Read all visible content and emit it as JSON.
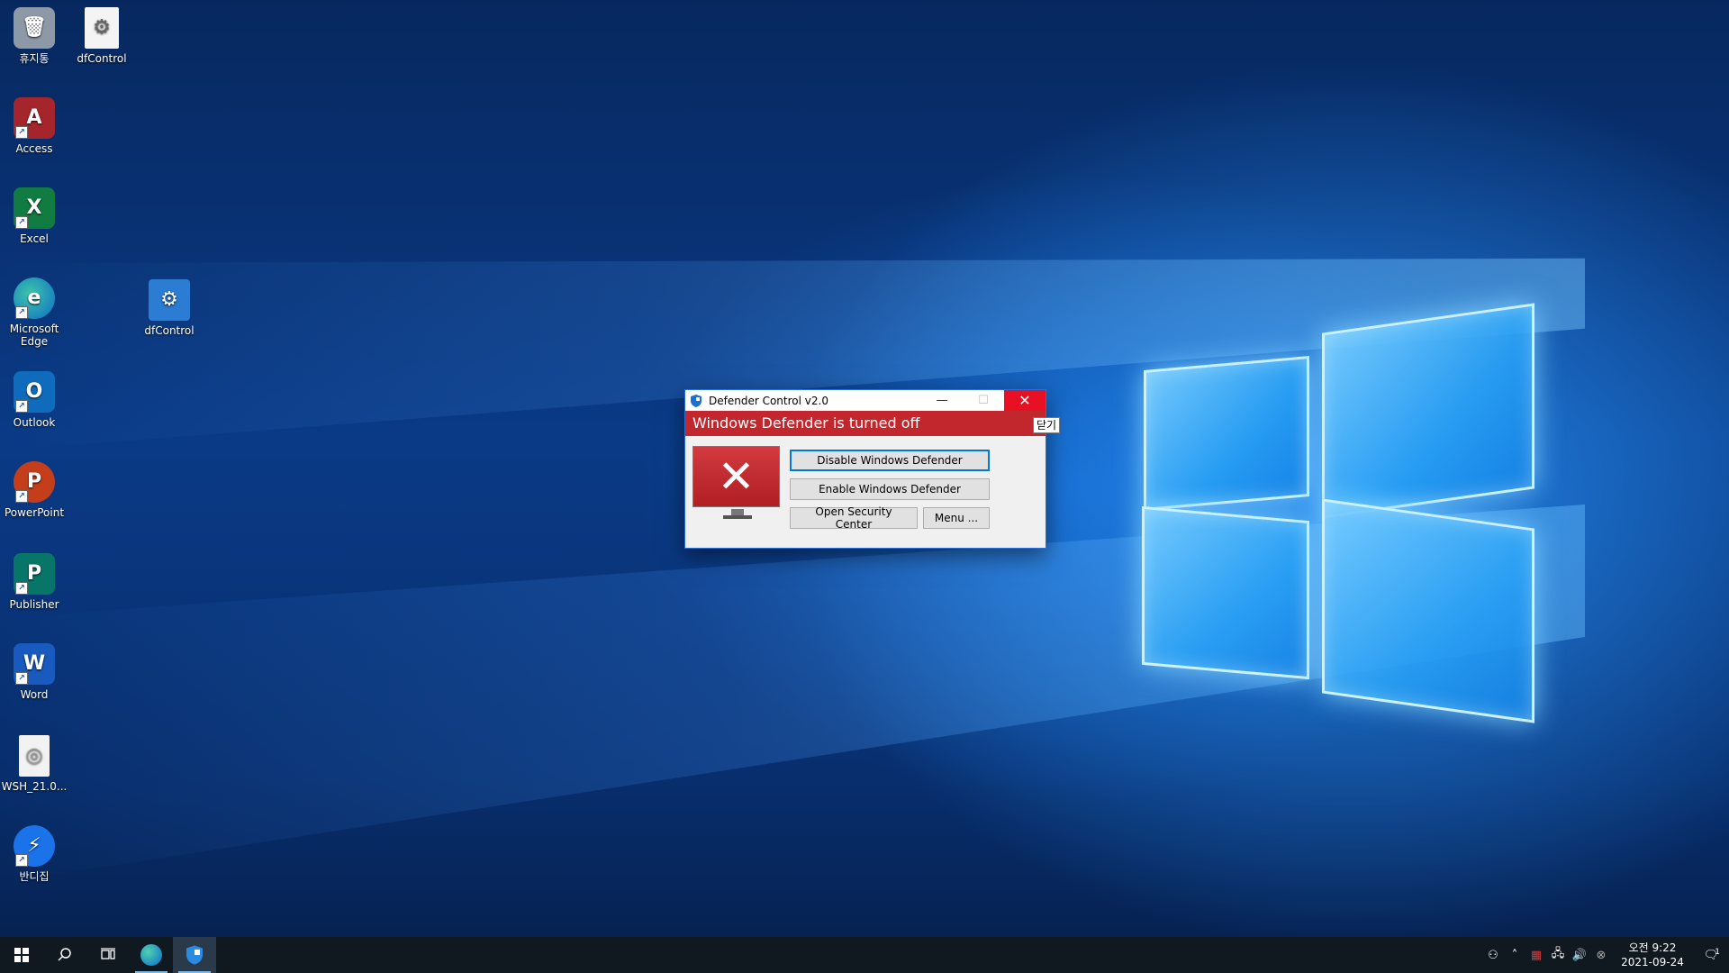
{
  "desktop": {
    "icons": [
      {
        "label": "휴지통",
        "glyph": "🗑",
        "color": "#7f8c9a"
      },
      {
        "label": "dfControl",
        "glyph": "⚙",
        "color": "#f2f2f2"
      },
      {
        "label": "Access",
        "glyph": "A",
        "color": "#a4262c"
      },
      {
        "label": "Excel",
        "glyph": "X",
        "color": "#107c41"
      },
      {
        "label": "Microsoft Edge",
        "glyph": "e",
        "color": "#0f8a7d"
      },
      {
        "label": "dfControl",
        "glyph": "⚙",
        "color": "#2b7cd3"
      },
      {
        "label": "Outlook",
        "glyph": "O",
        "color": "#0f6cbd"
      },
      {
        "label": "PowerPoint",
        "glyph": "P",
        "color": "#c43e1c"
      },
      {
        "label": "Publisher",
        "glyph": "P",
        "color": "#077568"
      },
      {
        "label": "Word",
        "glyph": "W",
        "color": "#185abd"
      },
      {
        "label": "WSH_21.0...",
        "glyph": "◎",
        "color": "#eeeeee"
      },
      {
        "label": "반디집",
        "glyph": "⚡",
        "color": "#1a73e8"
      }
    ]
  },
  "dialog": {
    "title": "Defender Control v2.0",
    "status": "Windows Defender is turned off",
    "status_color": "#c1272d",
    "close_tooltip": "닫기",
    "buttons": {
      "disable": "Disable Windows Defender",
      "enable": "Enable Windows Defender",
      "security_center": "Open Security Center",
      "menu": "Menu ..."
    }
  },
  "taskbar": {
    "start_icon": "windows-logo-icon",
    "clock_time": "오전 9:22",
    "clock_date": "2021-09-24",
    "notification_count": "1"
  }
}
